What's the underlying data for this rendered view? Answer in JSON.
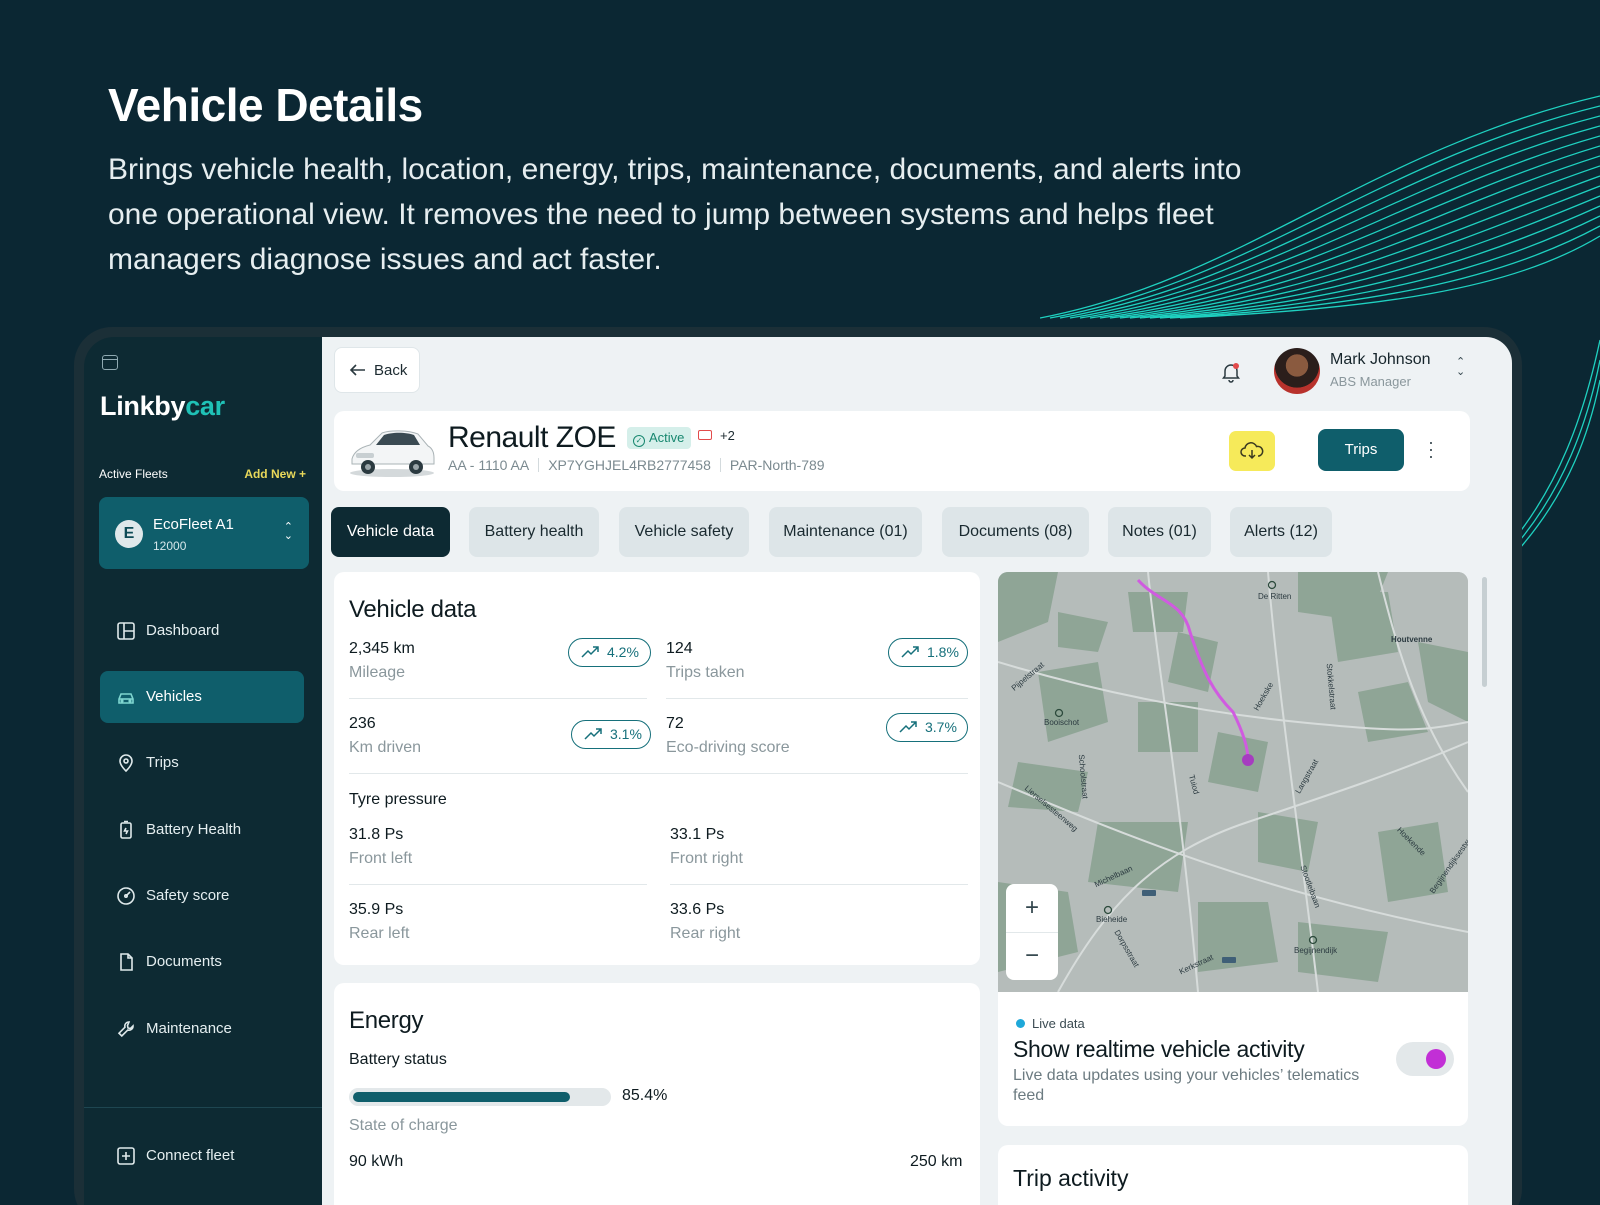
{
  "hero": {
    "title": "Vehicle Details",
    "description": "Brings vehicle health, location, energy, trips, maintenance, documents, and alerts into one operational view. It removes the need to jump between systems and helps fleet managers diagnose issues and act faster."
  },
  "sidebar": {
    "logo_main": "Linkby",
    "logo_accent": "car",
    "active_fleets_label": "Active Fleets",
    "add_new_label": "Add New +",
    "fleet": {
      "initial": "E",
      "name": "EcoFleet A1",
      "count": "12000"
    },
    "items": [
      {
        "label": "Dashboard",
        "icon": "dashboard-icon"
      },
      {
        "label": "Vehicles",
        "icon": "car-icon",
        "active": true
      },
      {
        "label": "Trips",
        "icon": "location-pin-icon"
      },
      {
        "label": "Battery Health",
        "icon": "battery-icon"
      },
      {
        "label": "Safety score",
        "icon": "gauge-icon"
      },
      {
        "label": "Documents",
        "icon": "document-icon"
      },
      {
        "label": "Maintenance",
        "icon": "wrench-icon"
      }
    ],
    "connect_label": "Connect fleet"
  },
  "header": {
    "back_label": "Back",
    "user": {
      "name": "Mark Johnson",
      "role": "ABS Manager"
    }
  },
  "vehicle": {
    "name": "Renault ZOE",
    "status": "Active",
    "extra": "+2",
    "plate": "AA - 1110 AA",
    "vin": "XP7YGHJEL4RB2777458",
    "region": "PAR-North-789",
    "trips_button": "Trips"
  },
  "tabs": [
    {
      "label": "Vehicle data",
      "active": true
    },
    {
      "label": "Battery health"
    },
    {
      "label": "Vehicle safety"
    },
    {
      "label": "Maintenance (01)"
    },
    {
      "label": "Documents (08)"
    },
    {
      "label": "Notes (01)"
    },
    {
      "label": "Alerts (12)"
    }
  ],
  "vehicle_data": {
    "title": "Vehicle data",
    "metrics": [
      {
        "value": "2,345 km",
        "label": "Mileage",
        "change": "4.2%"
      },
      {
        "value": "124",
        "label": "Trips taken",
        "change": "1.8%"
      },
      {
        "value": "236",
        "label": "Km driven",
        "change": "3.1%"
      },
      {
        "value": "72",
        "label": "Eco-driving score",
        "change": "3.7%"
      }
    ],
    "tyre_title": "Tyre pressure",
    "tyres": [
      {
        "value": "31.8 Ps",
        "label": "Front left"
      },
      {
        "value": "33.1 Ps",
        "label": "Front right"
      },
      {
        "value": "35.9 Ps",
        "label": "Rear left"
      },
      {
        "value": "33.6 Ps",
        "label": "Rear right"
      }
    ]
  },
  "energy": {
    "title": "Energy",
    "battery_status_label": "Battery status",
    "charge_percent": 85.4,
    "charge_text": "85.4%",
    "state_label": "State of charge",
    "capacity": "90 kWh",
    "range": "250 km"
  },
  "map": {
    "labels": [
      "De Ritten",
      "Houtvenne",
      "Booischot",
      "Bieheide",
      "Begijnendijk",
      "Pijpelstraat",
      "Hoekske",
      "Langstraat",
      "Schoolstraat",
      "Lierselsesteenweg",
      "Michelbaan",
      "Dorpsstraat",
      "Kerkstraat",
      "Tuiod",
      "Stootleibaan",
      "Hoekende",
      "Begijnendijksestw",
      "Stokkelstraat"
    ],
    "zoom_in": "+",
    "zoom_out": "−"
  },
  "live": {
    "tag": "Live data",
    "title": "Show realtime vehicle activity",
    "description": "Live data updates using your vehicles’ telematics feed",
    "enabled": true
  },
  "trip_activity": {
    "title": "Trip activity"
  },
  "colors": {
    "accent": "#0f5e6b",
    "sidebar": "#0d2a33",
    "brand": "#1fc1b6",
    "route": "#c22fd6",
    "cta": "#f6ea5a"
  }
}
